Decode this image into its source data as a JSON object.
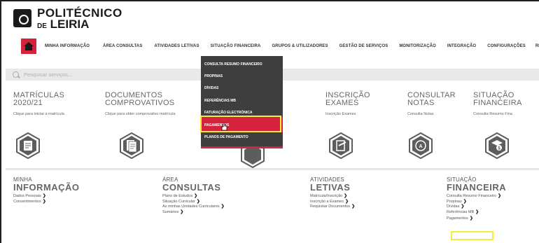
{
  "logo": {
    "line1": "POLITÉCNICO",
    "de": "DE",
    "line2": "LEIRIA"
  },
  "topnav": [
    "MINHA INFORMAÇÃO",
    "ÁREA CONSULTAS",
    "ATIVIDADES LETIVAS",
    "SITUAÇÃO FINANCEIRA",
    "GRUPOS & UTILIZADORES",
    "GESTÃO DE SERVIÇOS",
    "MONITORIZAÇÃO",
    "INTEGRAÇÃO",
    "CONFIGURAÇÕES",
    "RE"
  ],
  "search": {
    "placeholder": "Pesquisar serviços..."
  },
  "cards": [
    {
      "title1": "MATRÍCULAS",
      "title2": "2020/21",
      "sub": "Clique para iniciar a matrícula"
    },
    {
      "title1": "DOCUMENTOS",
      "title2": "COMPROVATIVOS",
      "sub": "Clique para obter comprovativo matrícula"
    },
    {
      "title1": "INSCRIÇÃO",
      "title2": "EXAMES",
      "sub": "Inscrição Exames"
    },
    {
      "title1": "CONSULTAR",
      "title2": "NOTAS",
      "sub": "Consulta Notas"
    },
    {
      "title1": "SITUAÇÃO",
      "title2": "FINANCEIRA",
      "sub": "Consulta Resumo Fina"
    }
  ],
  "dropdown": [
    "CONSULTA RESUMO FINANCEIRO",
    "PROPINAS",
    "DÍVIDAS",
    "REFERÊNCIAS MB",
    "FATURAÇÃO ELECTRÓNICA",
    "PAGAMENTOS",
    "PLANOS DE PAGAMENTO"
  ],
  "sections": [
    {
      "line1": "MINHA",
      "line2": "INFORMAÇÃO",
      "links": [
        "Dados Pessoais",
        "Consentimentos"
      ]
    },
    {
      "line1": "ÁREA",
      "line2": "CONSULTAS",
      "links": [
        "Plano de Estudos",
        "Situação Curricular",
        "As minhas Unidades Curriculares",
        "Sumários"
      ]
    },
    {
      "line1": "ATIVIDADES",
      "line2": "LETIVAS",
      "links": [
        "Matrícula/Inscrição",
        "Inscrição a Exames",
        "Requisitar Documentos"
      ]
    },
    {
      "line1": "SITUAÇÃO",
      "line2": "FINANCEIRA",
      "links": [
        "Consulta Resumo Financeiro",
        "Propinas",
        "Dívidas",
        "Referências MB",
        "Pagamentos"
      ]
    }
  ],
  "colors": {
    "accent": "#d6233c",
    "highlight": "#f3ee3a",
    "menu_bg": "#3e3e3e"
  }
}
